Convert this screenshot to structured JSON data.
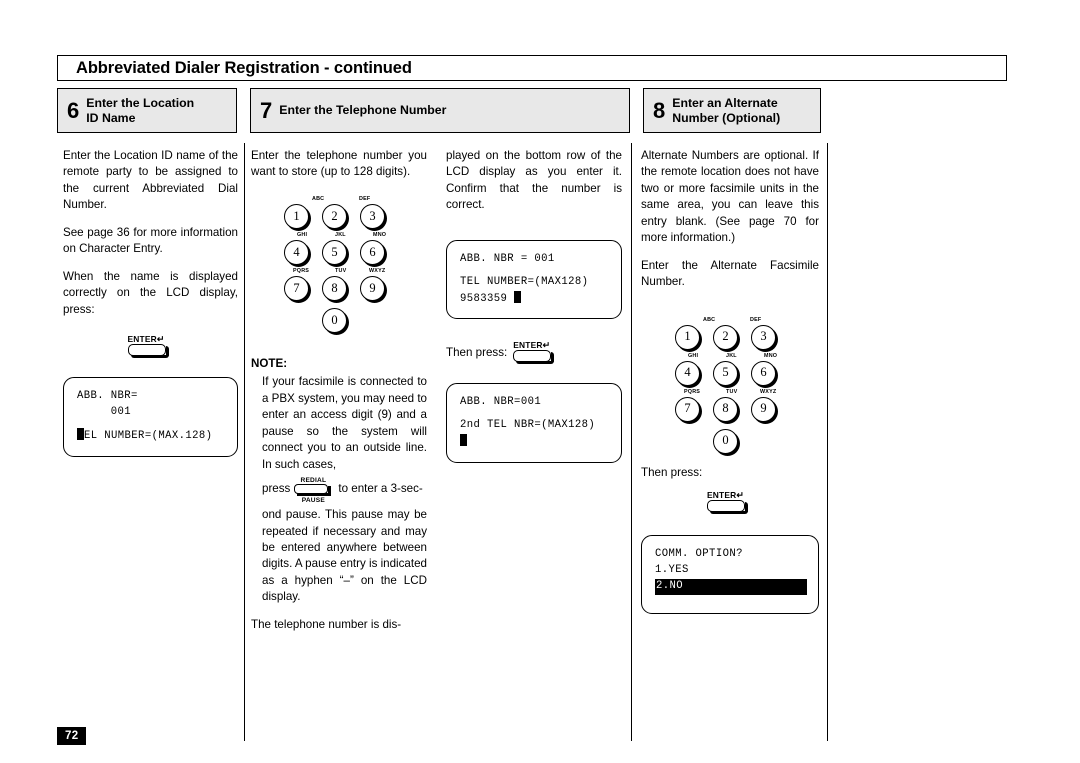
{
  "header": {
    "title": "Abbreviated Dialer Registration - continued"
  },
  "steps": [
    {
      "number": "6",
      "label_line1": "Enter the Location",
      "label_line2": "ID Name"
    },
    {
      "number": "7",
      "label_line1": "Enter the Telephone Number",
      "label_line2": ""
    },
    {
      "number": "8",
      "label_line1": "Enter an Alternate",
      "label_line2": "Number (Optional)"
    }
  ],
  "column1": {
    "para1": "Enter the Location ID name of the remote party to be assigned to the current Abbreviated Dial Number.",
    "para2": "See page 36 for more information on  Character Entry.",
    "para3": "When the name is displayed correctly on the LCD display, press:",
    "enter_key": {
      "cap": "ENTER",
      "arrow": "↵"
    },
    "lcd": {
      "line1": "ABB. NBR=",
      "line2": "     001",
      "line3_text": "EL NUMBER=(MAX.128)"
    }
  },
  "column2": {
    "para1": "Enter the telephone number you want to store (up to 128 digits).",
    "keypad": {
      "keys": [
        {
          "digit": "1",
          "letters": ""
        },
        {
          "digit": "2",
          "letters": "ABC"
        },
        {
          "digit": "3",
          "letters": "DEF"
        },
        {
          "digit": "4",
          "letters": "GHI"
        },
        {
          "digit": "5",
          "letters": "JKL"
        },
        {
          "digit": "6",
          "letters": "MNO"
        },
        {
          "digit": "7",
          "letters": "PQRS"
        },
        {
          "digit": "8",
          "letters": "TUV"
        },
        {
          "digit": "9",
          "letters": "WXYZ"
        },
        {
          "digit": "0",
          "letters": ""
        }
      ]
    },
    "note_title": "NOTE:",
    "note_part1": "If your facsimile is connected to a PBX system, you may need to enter an access digit (9) and a pause so the system will connect you to an outside line. In such cases,",
    "redial_line_prefix": "press",
    "redial_key": {
      "cap": "REDIAL",
      "sub": "PAUSE"
    },
    "redial_line_suffix": "to enter a 3-sec-",
    "note_part2": "ond pause. This pause may be repeated if necessary and may be entered anywhere between digits. A pause entry is indicated as a hyphen “–” on the LCD display.",
    "para_last": "The telephone number is dis-"
  },
  "column3": {
    "para1": "played on the bottom row of the LCD display as you enter it. Confirm that the number is correct.",
    "lcd1": {
      "line1": "ABB. NBR = 001",
      "line2": "TEL NUMBER=(MAX128)",
      "line3": "9583359 "
    },
    "then_press_label": "Then press:",
    "enter_key": {
      "cap": "ENTER",
      "arrow": "↵"
    },
    "lcd2": {
      "line1": "ABB. NBR=001",
      "line2": "2nd TEL NBR=(MAX128)",
      "line3": ""
    }
  },
  "column4": {
    "para1": "Alternate Numbers are optional. If the remote location does not have two or more facsimile units in the same area, you can leave this entry blank. (See page 70 for more information.)",
    "para2": "Enter the Alternate Facsimile Number.",
    "keypad": {
      "keys": [
        {
          "digit": "1",
          "letters": ""
        },
        {
          "digit": "2",
          "letters": "ABC"
        },
        {
          "digit": "3",
          "letters": "DEF"
        },
        {
          "digit": "4",
          "letters": "GHI"
        },
        {
          "digit": "5",
          "letters": "JKL"
        },
        {
          "digit": "6",
          "letters": "MNO"
        },
        {
          "digit": "7",
          "letters": "PQRS"
        },
        {
          "digit": "8",
          "letters": "TUV"
        },
        {
          "digit": "9",
          "letters": "WXYZ"
        },
        {
          "digit": "0",
          "letters": ""
        }
      ]
    },
    "then_press_label": "Then press:",
    "enter_key": {
      "cap": "ENTER",
      "arrow": "↵"
    },
    "lcd": {
      "line1": "COMM. OPTION?",
      "line2": "1.YES",
      "line3_highlighted": "2.NO"
    }
  },
  "footer": {
    "page_number": "72"
  },
  "colors": {
    "ink": "#000000",
    "paper": "#ffffff",
    "step_box_fill": "#e8e8e8"
  }
}
